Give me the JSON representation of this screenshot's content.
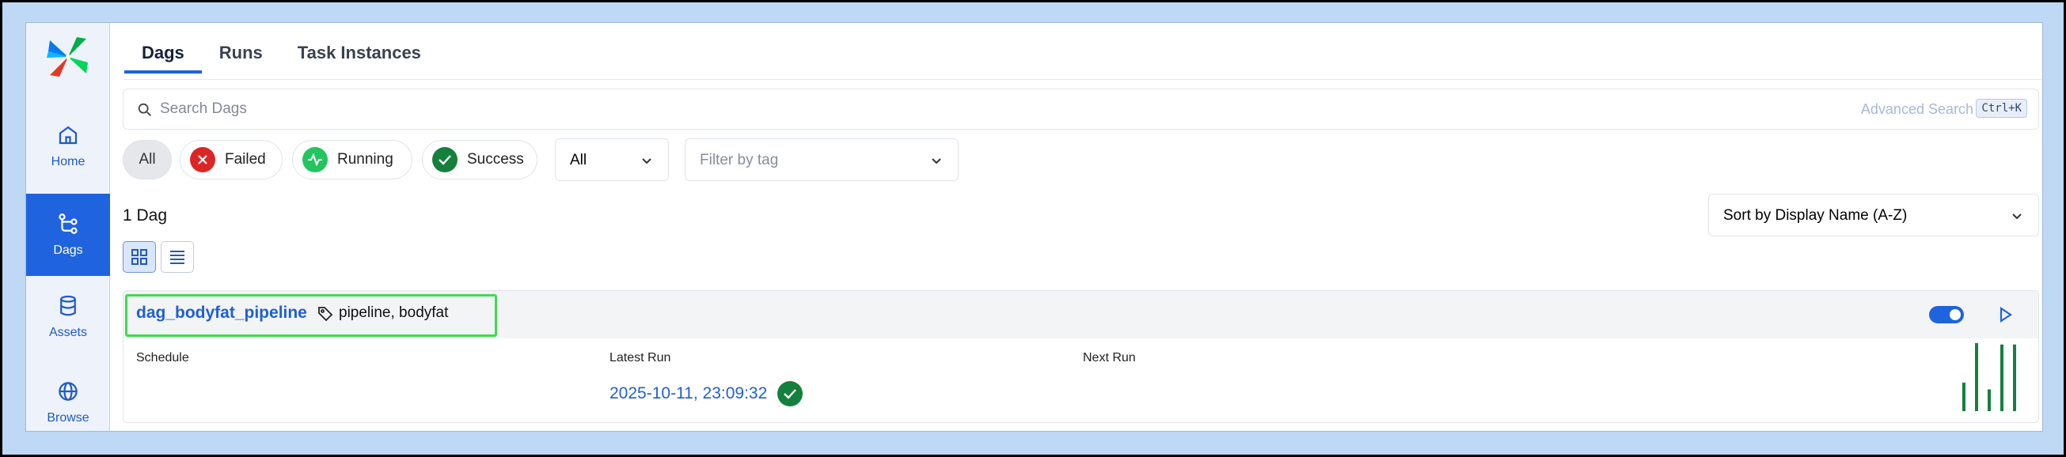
{
  "sidebar": {
    "items": [
      {
        "label": "Home",
        "icon": "home-icon"
      },
      {
        "label": "Dags",
        "icon": "dags-icon",
        "active": true
      },
      {
        "label": "Assets",
        "icon": "database-icon"
      },
      {
        "label": "Browse",
        "icon": "globe-icon"
      }
    ]
  },
  "tabs": [
    {
      "label": "Dags",
      "active": true
    },
    {
      "label": "Runs"
    },
    {
      "label": "Task Instances"
    }
  ],
  "search": {
    "placeholder": "Search Dags",
    "advanced_label": "Advanced Search",
    "shortcut": "Ctrl+K"
  },
  "filters": {
    "state_chips": [
      {
        "label": "All",
        "selected": true
      },
      {
        "label": "Failed",
        "icon": "x-circle-icon",
        "color": "#dc2626"
      },
      {
        "label": "Running",
        "icon": "activity-icon",
        "color": "#22c55e"
      },
      {
        "label": "Success",
        "icon": "check-circle-icon",
        "color": "#15803d"
      }
    ],
    "paused_select": "All",
    "tag_placeholder": "Filter by tag"
  },
  "results": {
    "count_label": "1 Dag",
    "sort_label": "Sort by Display Name (A-Z)"
  },
  "dag_card": {
    "name": "dag_bodyfat_pipeline",
    "tags": "pipeline, bodyfat",
    "enabled": true,
    "columns": {
      "schedule": "Schedule",
      "latest_run": "Latest Run",
      "next_run": "Next Run"
    },
    "latest_run_value": "2025-10-11, 23:09:32",
    "latest_run_state": "success",
    "recent_runs_durations": [
      0.42,
      1.0,
      0.32,
      0.98,
      0.98
    ],
    "bar_color": "#15803d"
  },
  "colors": {
    "accent": "#1f63de",
    "frame": "#bed8f5",
    "highlight": "#3ddc4e"
  }
}
